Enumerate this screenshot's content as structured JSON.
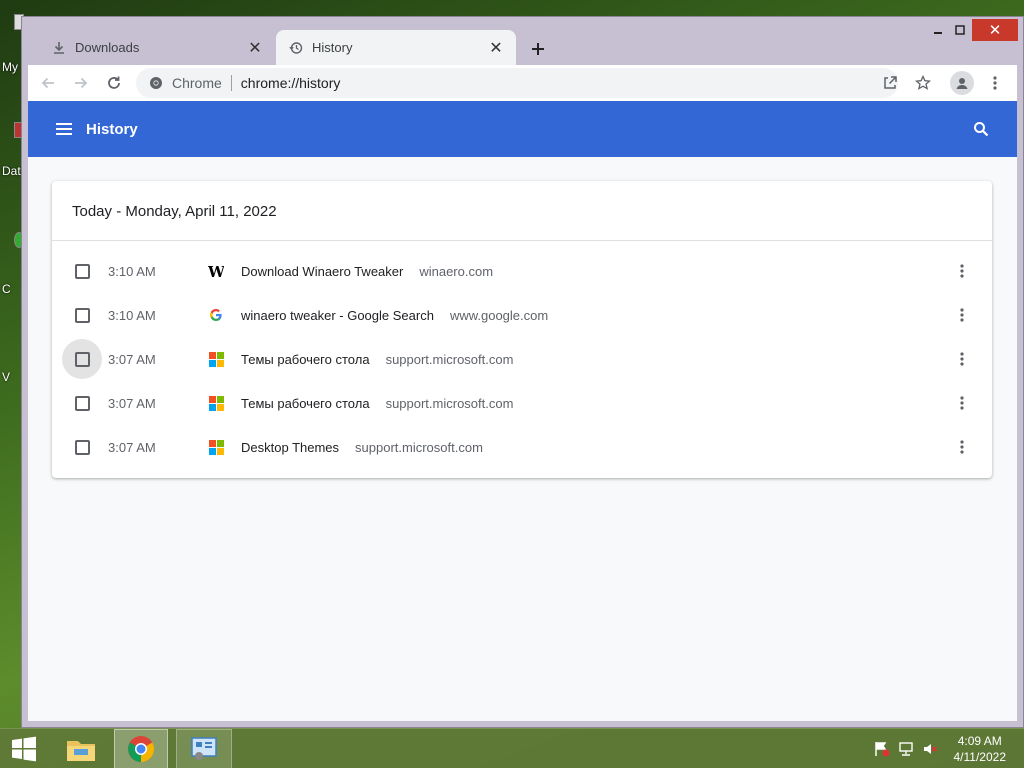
{
  "desktop": {
    "fragments": [
      "My",
      "Dat",
      "C",
      "V"
    ]
  },
  "window": {
    "tabs": [
      {
        "label": "Downloads",
        "icon": "download-icon",
        "active": false
      },
      {
        "label": "History",
        "icon": "history-icon",
        "active": true
      }
    ]
  },
  "toolbar": {
    "omnibox_label": "Chrome",
    "url": "chrome://history"
  },
  "history_page": {
    "title": "History",
    "date_heading": "Today - Monday, April 11, 2022",
    "entries": [
      {
        "time": "3:10 AM",
        "title": "Download Winaero Tweaker",
        "domain": "winaero.com",
        "favicon": "winaero-icon"
      },
      {
        "time": "3:10 AM",
        "title": "winaero tweaker - Google Search",
        "domain": "www.google.com",
        "favicon": "google-icon"
      },
      {
        "time": "3:07 AM",
        "title": "Темы рабочего стола",
        "domain": "support.microsoft.com",
        "favicon": "microsoft-icon"
      },
      {
        "time": "3:07 AM",
        "title": "Темы рабочего стола",
        "domain": "support.microsoft.com",
        "favicon": "microsoft-icon"
      },
      {
        "time": "3:07 AM",
        "title": "Desktop Themes",
        "domain": "support.microsoft.com",
        "favicon": "microsoft-icon"
      }
    ]
  },
  "taskbar": {
    "time": "4:09 AM",
    "date": "4/11/2022"
  },
  "colors": {
    "header_blue": "#3367d6",
    "ms_red": "#f25022",
    "ms_green": "#7fba00",
    "ms_blue": "#00a4ef",
    "ms_yellow": "#ffb900"
  }
}
